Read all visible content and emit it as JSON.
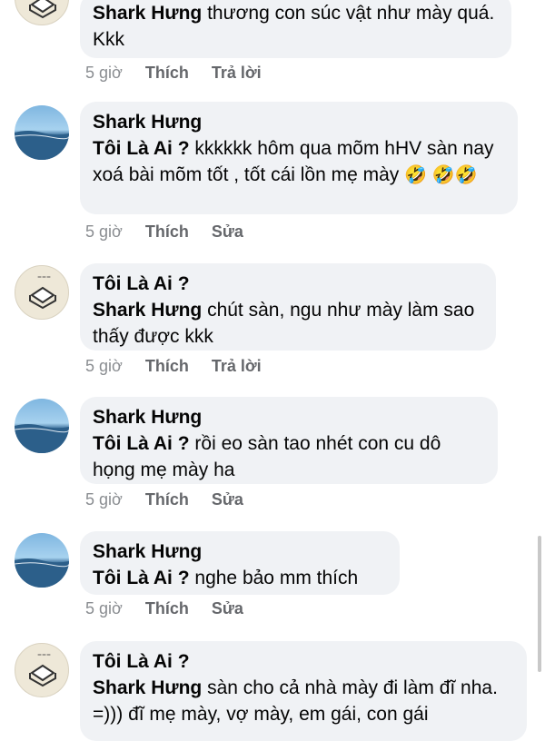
{
  "comments": [
    {
      "author": "",
      "mention": "Shark Hưng",
      "text": " thương con súc vật như mày quá. Kkk",
      "time": "5 giờ",
      "like": "Thích",
      "action": "Trả lời"
    },
    {
      "author": "Shark Hưng",
      "mention": "Tôi Là Ai ?",
      "text": " kkkkkk hôm qua mõm hHV sàn nay xoá bài mõm tốt , tốt cái lồn mẹ mày",
      "emoji": "🤣 🤣🤣",
      "time": "5 giờ",
      "like": "Thích",
      "action": "Sửa"
    },
    {
      "author": "Tôi Là Ai ?",
      "mention": "Shark Hưng",
      "text": " chút sàn, ngu như mày làm sao thấy được kkk",
      "time": "5 giờ",
      "like": "Thích",
      "action": "Trả lời"
    },
    {
      "author": "Shark Hưng",
      "mention": "Tôi Là Ai ?",
      "text": " rồi eo sàn tao nhét con cu dô họng mẹ mày ha",
      "time": "5 giờ",
      "like": "Thích",
      "action": "Sửa"
    },
    {
      "author": "Shark Hưng",
      "mention": "Tôi Là Ai ?",
      "text": " nghe bảo mm thích",
      "time": "5 giờ",
      "like": "Thích",
      "action": "Sửa"
    },
    {
      "author": "Tôi Là Ai ?",
      "mention": "Shark Hưng",
      "text": " sàn cho cả nhà mày đi làm đĩ nha. =))) đĩ mẹ mày, vợ mày, em gái, con gái"
    }
  ]
}
